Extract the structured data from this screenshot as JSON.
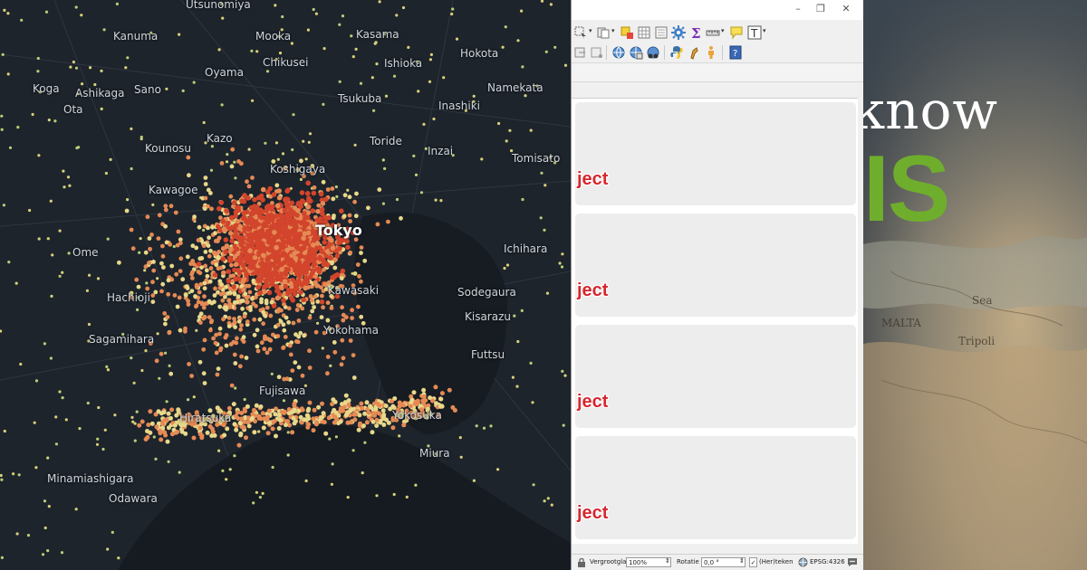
{
  "map": {
    "places": [
      {
        "name": "Utsunomiya"
      },
      {
        "name": "Kanuma"
      },
      {
        "name": "Mooka"
      },
      {
        "name": "Kasama"
      },
      {
        "name": "Chikusei"
      },
      {
        "name": "Oyama"
      },
      {
        "name": "Ishioka"
      },
      {
        "name": "Hokota"
      },
      {
        "name": "Koga"
      },
      {
        "name": "Ashikaga"
      },
      {
        "name": "Sano"
      },
      {
        "name": "Namekata"
      },
      {
        "name": "Ota"
      },
      {
        "name": "Tsukuba"
      },
      {
        "name": "Inashiki"
      },
      {
        "name": "Kazo"
      },
      {
        "name": "Kounosu"
      },
      {
        "name": "Toride"
      },
      {
        "name": "Inzai"
      },
      {
        "name": "Tomisato"
      },
      {
        "name": "Koshigaya"
      },
      {
        "name": "Kawagoe"
      },
      {
        "name": "Tokyo"
      },
      {
        "name": "Ome"
      },
      {
        "name": "Ichihara"
      },
      {
        "name": "Hachioji"
      },
      {
        "name": "Kawasaki"
      },
      {
        "name": "Sodegaura"
      },
      {
        "name": "Kisarazu"
      },
      {
        "name": "Sagamihara"
      },
      {
        "name": "Yokohama"
      },
      {
        "name": "Futtsu"
      },
      {
        "name": "Fujisawa"
      },
      {
        "name": "Hiratsuka"
      },
      {
        "name": "Yokosuka"
      },
      {
        "name": "Miura"
      },
      {
        "name": "Minamiashigara"
      },
      {
        "name": "Odawara"
      }
    ]
  },
  "qgis": {
    "window": {
      "minimize": "–",
      "maximize": "❐",
      "close": "✕"
    },
    "cards": [
      {
        "label": "ject"
      },
      {
        "label": "ject"
      },
      {
        "label": "ject"
      },
      {
        "label": "ject"
      }
    ],
    "status": {
      "zoom_label": "Vergrootglas",
      "zoom_value": "100%",
      "rotation_label": "Rotatie",
      "rotation_value": "0,0 °",
      "render_label": "(Her)teken",
      "crs": "EPSG:4326"
    }
  },
  "banner": {
    "word_top": "know",
    "word_bottom": "IS"
  },
  "colors": {
    "accent_green": "#6fae2c",
    "error_red": "#d6272e",
    "point_red": "#d2452c",
    "point_orange": "#e58a55",
    "point_yellow": "#e7d88a"
  }
}
